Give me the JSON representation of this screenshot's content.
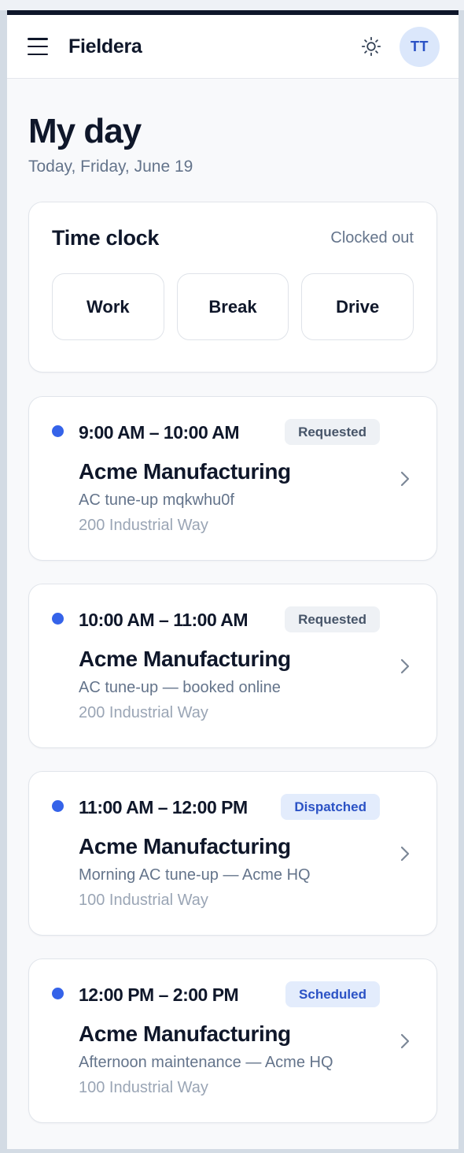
{
  "app": {
    "brand": "Fieldera",
    "avatar_initials": "TT"
  },
  "icons": {
    "menu": "hamburger-menu-icon",
    "theme": "sun-icon",
    "chevron": "chevron-right-icon"
  },
  "colors": {
    "accent": "#3563e9",
    "dark": "#0f172a",
    "muted": "#64748b"
  },
  "page": {
    "title": "My day",
    "subtitle": "Today, Friday, June 19"
  },
  "time_clock": {
    "title": "Time clock",
    "status": "Clocked out",
    "buttons": [
      "Work",
      "Break",
      "Drive"
    ]
  },
  "jobs": [
    {
      "time": "9:00 AM – 10:00 AM",
      "status": "Requested",
      "status_style": "gray",
      "customer": "Acme Manufacturing",
      "description": "AC tune-up mqkwhu0f",
      "address": "200 Industrial Way"
    },
    {
      "time": "10:00 AM – 11:00 AM",
      "status": "Requested",
      "status_style": "gray",
      "customer": "Acme Manufacturing",
      "description": "AC tune-up — booked online",
      "address": "200 Industrial Way"
    },
    {
      "time": "11:00 AM – 12:00 PM",
      "status": "Dispatched",
      "status_style": "blue",
      "customer": "Acme Manufacturing",
      "description": "Morning AC tune-up — Acme HQ",
      "address": "100 Industrial Way"
    },
    {
      "time": "12:00 PM – 2:00 PM",
      "status": "Scheduled",
      "status_style": "blue",
      "customer": "Acme Manufacturing",
      "description": "Afternoon maintenance — Acme HQ",
      "address": "100 Industrial Way"
    }
  ]
}
